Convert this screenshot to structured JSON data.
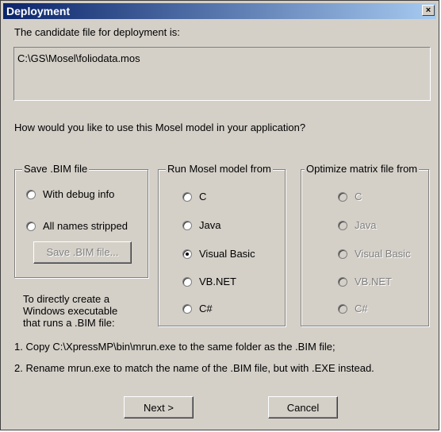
{
  "window": {
    "title": "Deployment",
    "close_glyph": "×"
  },
  "candidate_label": "The candidate file for deployment is:",
  "candidate_path": "C:\\GS\\Mosel\\foliodata.mos",
  "question": "How would you like to use this Mosel model in your application?",
  "save_group": {
    "title": "Save .BIM file",
    "options": [
      "With debug info",
      "All names stripped"
    ],
    "button": "Save .BIM file..."
  },
  "run_group": {
    "title": "Run Mosel model from",
    "options": [
      "C",
      "Java",
      "Visual Basic",
      "VB.NET",
      "C#"
    ],
    "selected": "Visual Basic"
  },
  "optimize_group": {
    "title": "Optimize matrix file from",
    "options": [
      "C",
      "Java",
      "Visual Basic",
      "VB.NET",
      "C#"
    ]
  },
  "exe_note": [
    "To directly create a",
    "Windows executable",
    "that runs a .BIM file:"
  ],
  "steps": [
    "1. Copy  C:\\XpressMP\\bin\\mrun.exe to the same folder as the .BIM file;",
    "2. Rename mrun.exe to match the name of the .BIM file, but with .EXE instead."
  ],
  "buttons": {
    "next": "Next >",
    "cancel": "Cancel"
  }
}
